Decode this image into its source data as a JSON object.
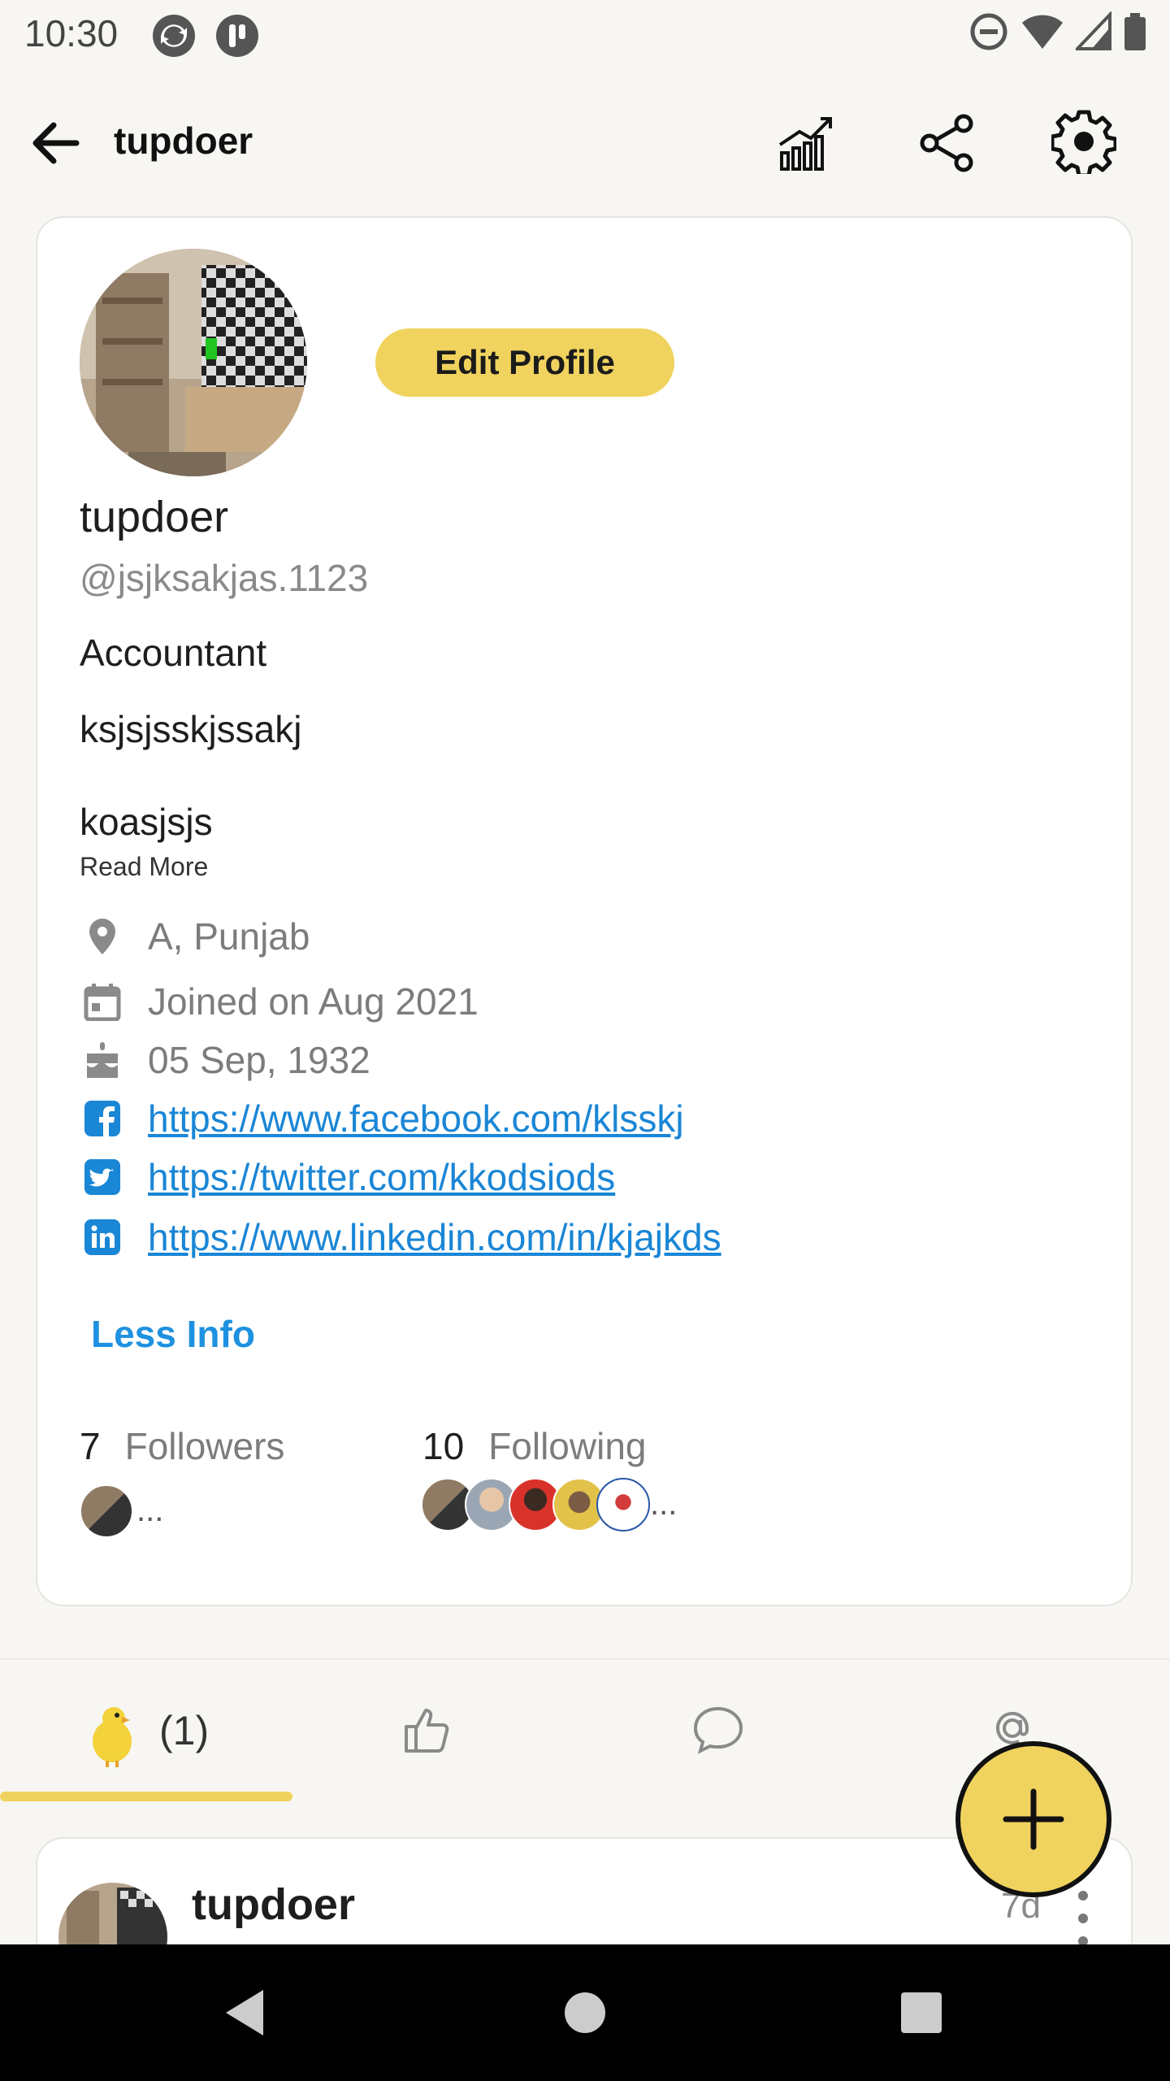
{
  "status_bar": {
    "time": "10:30"
  },
  "app_bar": {
    "title": "tupdoer",
    "icons": [
      "back-arrow-icon",
      "analytics-icon",
      "share-icon",
      "settings-icon"
    ]
  },
  "profile": {
    "edit_button_label": "Edit Profile",
    "display_name": "tupdoer",
    "handle": "@jsjksakjas.1123",
    "occupation": "Accountant",
    "bio_line1": "ksjsjsskjssakj",
    "bio_line2": "koasjsjs",
    "read_more": "Read More",
    "location": "A, Punjab",
    "joined": "Joined on Aug 2021",
    "birthday": "05 Sep, 1932",
    "facebook": "https://www.facebook.com/klsskj",
    "twitter": "https://twitter.com/kkodsiods",
    "linkedin": "https://www.linkedin.com/in/kjajkds",
    "less_info": "Less Info",
    "followers_count": "7",
    "followers_label": "Followers",
    "following_count": "10",
    "following_label": "Following",
    "ellipsis": "..."
  },
  "tabs": {
    "posts_count": "(1)"
  },
  "post_preview": {
    "author": "tupdoer",
    "time": "7d"
  },
  "colors": {
    "accent": "#f0d35e",
    "link": "#1a86d6"
  }
}
